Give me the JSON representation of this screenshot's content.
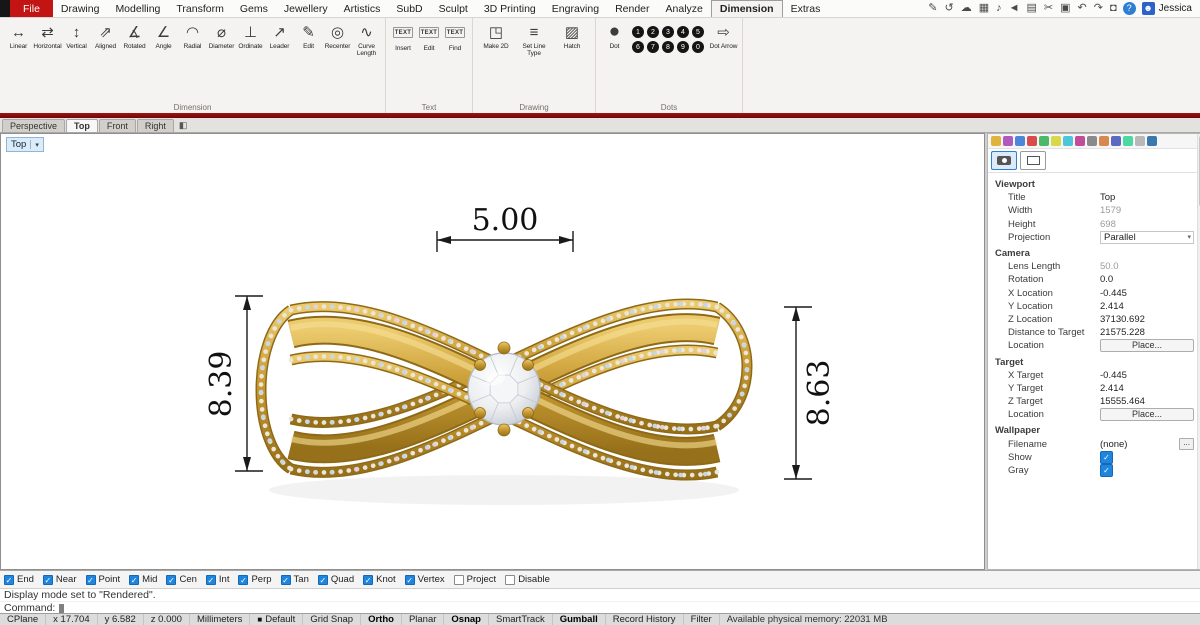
{
  "menubar": {
    "file_label": "File",
    "tabs": [
      {
        "label": "Drawing",
        "name": "menu-tab-drawing"
      },
      {
        "label": "Modelling",
        "name": "menu-tab-modelling"
      },
      {
        "label": "Transform",
        "name": "menu-tab-transform"
      },
      {
        "label": "Gems",
        "name": "menu-tab-gems"
      },
      {
        "label": "Jewellery",
        "name": "menu-tab-jewellery"
      },
      {
        "label": "Artistics",
        "name": "menu-tab-artistics"
      },
      {
        "label": "SubD",
        "name": "menu-tab-subd"
      },
      {
        "label": "Sculpt",
        "name": "menu-tab-sculpt"
      },
      {
        "label": "3D Printing",
        "name": "menu-tab-3d-printing"
      },
      {
        "label": "Engraving",
        "name": "menu-tab-engraving"
      },
      {
        "label": "Render",
        "name": "menu-tab-render"
      },
      {
        "label": "Analyze",
        "name": "menu-tab-analyze"
      },
      {
        "label": "Dimension",
        "cls": "active",
        "name": "menu-tab-dimension"
      },
      {
        "label": "Extras",
        "name": "menu-tab-extras"
      }
    ],
    "right_icons": [
      {
        "name": "annotate-icon",
        "glyph": "✎"
      },
      {
        "name": "history-icon",
        "glyph": "↺"
      },
      {
        "name": "cloud-icon",
        "glyph": "☁"
      },
      {
        "name": "calendar-icon",
        "glyph": "▦"
      },
      {
        "name": "microphone-icon",
        "glyph": "♪"
      },
      {
        "name": "speaker-icon",
        "glyph": "◄"
      },
      {
        "name": "paste-icon",
        "glyph": "▤"
      },
      {
        "name": "cut-icon",
        "glyph": "✂"
      },
      {
        "name": "copy-icon",
        "glyph": "▣"
      },
      {
        "name": "undo-icon",
        "glyph": "↶"
      },
      {
        "name": "redo-icon",
        "glyph": "↷"
      },
      {
        "name": "save-icon",
        "glyph": "◘"
      }
    ],
    "help_glyph": "?",
    "user_glyph": "☻",
    "user": "Jessica"
  },
  "ribbon": {
    "dimension": {
      "label": "Dimension",
      "tools": [
        {
          "label": "Linear",
          "glyph": "↔",
          "name": "linear-dimension-tool",
          "icon": "linear-dimension-icon"
        },
        {
          "label": "Horizontal",
          "glyph": "⇄",
          "name": "horizontal-dimension-tool",
          "icon": "horizontal-dimension-icon"
        },
        {
          "label": "Vertical",
          "glyph": "↕",
          "name": "vertical-dimension-tool",
          "icon": "vertical-dimension-icon"
        },
        {
          "label": "Aligned",
          "glyph": "⇗",
          "name": "aligned-dimension-tool",
          "icon": "aligned-dimension-icon"
        },
        {
          "label": "Rotated",
          "glyph": "∡",
          "name": "rotated-dimension-tool",
          "icon": "rotated-dimension-icon"
        },
        {
          "label": "Angle",
          "glyph": "∠",
          "name": "angle-dimension-tool",
          "icon": "angle-dimension-icon"
        },
        {
          "label": "Radial",
          "glyph": "◠",
          "name": "radial-dimension-tool",
          "icon": "radial-dimension-icon"
        },
        {
          "label": "Diameter",
          "glyph": "⌀",
          "name": "diameter-dimension-tool",
          "icon": "diameter-dimension-icon"
        },
        {
          "label": "Ordinate",
          "glyph": "⊥",
          "name": "ordinate-dimension-tool",
          "icon": "ordinate-dimension-icon"
        },
        {
          "label": "Leader",
          "glyph": "↗",
          "name": "leader-tool",
          "icon": "leader-icon"
        },
        {
          "label": "Edit",
          "glyph": "✎",
          "name": "edit-dimension-tool",
          "icon": "edit-dimension-icon"
        },
        {
          "label": "Recenter",
          "glyph": "◎",
          "name": "recenter-tool",
          "icon": "recenter-icon"
        },
        {
          "label": "Curve Length",
          "glyph": "∿",
          "name": "curve-length-tool",
          "icon": "curve-length-icon"
        }
      ]
    },
    "text": {
      "label": "Text",
      "tools": [
        {
          "label": "Insert",
          "glyph": "TEXT",
          "cls": "texticon",
          "name": "text-insert-tool",
          "icon": "text-insert-icon"
        },
        {
          "label": "Edit",
          "glyph": "TEXT",
          "cls": "texticon",
          "name": "text-edit-tool",
          "icon": "text-edit-icon"
        },
        {
          "label": "Find",
          "glyph": "TEXT",
          "cls": "texticon",
          "name": "text-find-tool",
          "icon": "text-find-icon"
        }
      ]
    },
    "drawing": {
      "label": "Drawing",
      "tools": [
        {
          "label": "Make 2D",
          "glyph": "◳",
          "name": "make-2d-tool",
          "icon": "make-2d-icon"
        },
        {
          "label": "Set Line Type",
          "glyph": "≡",
          "name": "set-line-type-tool",
          "icon": "set-line-type-icon"
        },
        {
          "label": "Hatch",
          "glyph": "▨",
          "name": "hatch-tool",
          "icon": "hatch-icon"
        }
      ]
    },
    "dots": {
      "label": "Dots",
      "dot_label": "Dot",
      "dot_glyph": "●",
      "numbers": [
        "1",
        "2",
        "3",
        "4",
        "5",
        "6",
        "7",
        "8",
        "9",
        "0"
      ],
      "arrow_label": "Dot Arrow",
      "arrow_glyph": "⇨"
    }
  },
  "viewport": {
    "tabs": [
      {
        "label": "Perspective",
        "name": "viewport-tab-perspective"
      },
      {
        "label": "Top",
        "cls": "active",
        "name": "viewport-tab-top"
      },
      {
        "label": "Front",
        "name": "viewport-tab-front"
      },
      {
        "label": "Right",
        "name": "viewport-tab-right"
      }
    ],
    "extra_glyph": "◧",
    "view_label": "Top",
    "title_arrow": "▾",
    "dims": {
      "top": "5.00",
      "left": "8.39",
      "right": "8.63"
    }
  },
  "panel": {
    "tab_icons": [
      {
        "color": "#e0b43c"
      },
      {
        "color": "#b05ac0"
      },
      {
        "color": "#4c86d8"
      },
      {
        "color": "#d84c4c"
      },
      {
        "color": "#4cb86a"
      },
      {
        "color": "#d8d84c"
      },
      {
        "color": "#4cc6d8"
      },
      {
        "color": "#c04c9a"
      },
      {
        "color": "#8a8a8a"
      },
      {
        "color": "#d8884c"
      },
      {
        "color": "#5a6ac0"
      },
      {
        "color": "#4cd8a0"
      },
      {
        "color": "#b8b8b8"
      },
      {
        "color": "#3c78b0"
      }
    ],
    "rows": [
      {
        "label": "Viewport",
        "cls": "header"
      },
      {
        "label": "Title",
        "value": "Top"
      },
      {
        "label": "Width",
        "value": "1579",
        "cls": "gray"
      },
      {
        "label": "Height",
        "value": "698",
        "cls": "gray"
      },
      {
        "label": "Projection",
        "value": "Parallel",
        "cls": "dropdown",
        "chevron": "▾"
      },
      {
        "label": "Camera",
        "cls": "header"
      },
      {
        "label": "Lens Length",
        "value": "50.0",
        "cls": "gray"
      },
      {
        "label": "Rotation",
        "value": "0.0"
      },
      {
        "label": "X Location",
        "value": "-0.445"
      },
      {
        "label": "Y Location",
        "value": "2.414"
      },
      {
        "label": "Z Location",
        "value": "37130.692"
      },
      {
        "label": "Distance to Target",
        "value": "21575.228"
      },
      {
        "label": "Location",
        "value": "Place...",
        "cls": "btn"
      },
      {
        "label": "Target",
        "cls": "header"
      },
      {
        "label": "X Target",
        "value": "-0.445"
      },
      {
        "label": "Y Target",
        "value": "2.414"
      },
      {
        "label": "Z Target",
        "value": "15555.464"
      },
      {
        "label": "Location",
        "value": "Place...",
        "cls": "btn"
      },
      {
        "label": "Wallpaper",
        "cls": "header"
      },
      {
        "label": "Filename",
        "value": "(none)",
        "cls": "file",
        "extra": "..."
      },
      {
        "label": "Show",
        "value": "✓",
        "cls": "check"
      },
      {
        "label": "Gray",
        "value": "✓",
        "cls": "check"
      }
    ]
  },
  "osnap": {
    "items": [
      {
        "label": "End",
        "cls": "on",
        "mark": "✓"
      },
      {
        "label": "Near",
        "cls": "on",
        "mark": "✓"
      },
      {
        "label": "Point",
        "cls": "on",
        "mark": "✓"
      },
      {
        "label": "Mid",
        "cls": "on",
        "mark": "✓"
      },
      {
        "label": "Cen",
        "cls": "on",
        "mark": "✓"
      },
      {
        "label": "Int",
        "cls": "on",
        "mark": "✓"
      },
      {
        "label": "Perp",
        "cls": "on",
        "mark": "✓"
      },
      {
        "label": "Tan",
        "cls": "on",
        "mark": "✓"
      },
      {
        "label": "Quad",
        "cls": "on",
        "mark": "✓"
      },
      {
        "label": "Knot",
        "cls": "on",
        "mark": "✓"
      },
      {
        "label": "Vertex",
        "cls": "on",
        "mark": "✓"
      },
      {
        "label": "Project",
        "cls": "",
        "mark": ""
      },
      {
        "label": "Disable",
        "cls": "",
        "mark": ""
      }
    ]
  },
  "command": {
    "history": "Display mode set to \"Rendered\".",
    "prompt": "Command:"
  },
  "statusbar": {
    "cells": [
      {
        "label": "CPlane",
        "name": "cplane-button"
      },
      {
        "label": "x 17.704",
        "name": "x-coordinate"
      },
      {
        "label": "y 6.582",
        "name": "y-coordinate"
      },
      {
        "label": "z 0.000",
        "name": "z-coordinate"
      },
      {
        "label": "Millimeters",
        "name": "units-indicator"
      },
      {
        "label": "Default",
        "name": "layer-indicator",
        "swatch": "■"
      },
      {
        "label": "Grid Snap",
        "name": "grid-snap-toggle"
      },
      {
        "label": "Ortho",
        "name": "ortho-toggle",
        "cls": "on"
      },
      {
        "label": "Planar",
        "name": "planar-toggle"
      },
      {
        "label": "Osnap",
        "name": "osnap-status-toggle",
        "cls": "on"
      },
      {
        "label": "SmartTrack",
        "name": "smarttrack-toggle"
      },
      {
        "label": "Gumball",
        "name": "gumball-toggle",
        "cls": "on"
      },
      {
        "label": "Record History",
        "name": "record-history-toggle"
      },
      {
        "label": "Filter",
        "name": "filter-toggle"
      },
      {
        "label": "Available physical memory: 22031 MB",
        "name": "memory-indicator",
        "cls": "mem"
      }
    ]
  }
}
